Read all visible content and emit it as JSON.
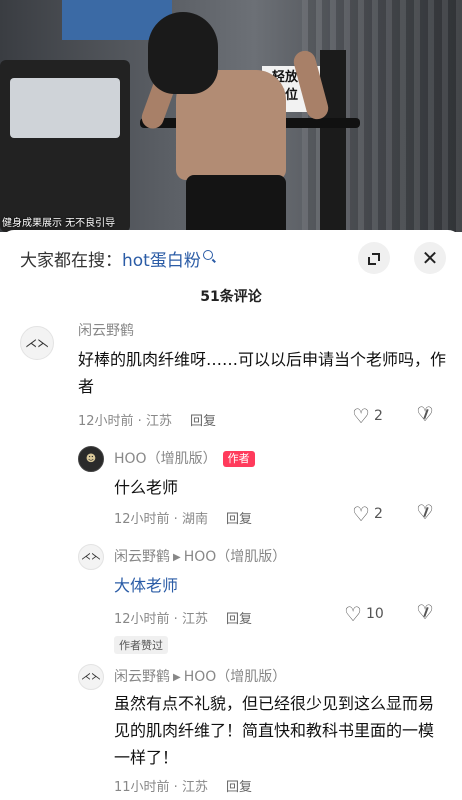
{
  "video": {
    "caption": "健身成果展示 无不良引导",
    "sign_text": "轻放\n归位"
  },
  "search": {
    "prefix": "大家都在搜：",
    "term": "hot蛋白粉"
  },
  "comment_count": "51条评论",
  "comments": [
    {
      "user": "闲云野鹤",
      "text": "好棒的肌肉纤维呀……可以以后申请当个老师吗，作者",
      "time": "12小时前 · 江苏",
      "reply": "回复",
      "likes": "2"
    },
    {
      "user": "HOO（增肌版）",
      "author_tag": "作者",
      "text": "什么老师",
      "time": "12小时前 · 湖南",
      "reply": "回复",
      "likes": "2"
    },
    {
      "user": "闲云野鹤",
      "reply_to": "HOO（增肌版）",
      "text": "大体老师",
      "time": "12小时前 · 江苏",
      "reply": "回复",
      "likes": "10",
      "liked_by_author": "作者赞过"
    },
    {
      "user": "闲云野鹤",
      "reply_to": "HOO（增肌版）",
      "text": "虽然有点不礼貌，但已经很少见到这么显而易见的肌肉纤维了！简直快和教科书里面的一模一样了！",
      "time": "11小时前 · 江苏",
      "reply": "回复"
    }
  ]
}
